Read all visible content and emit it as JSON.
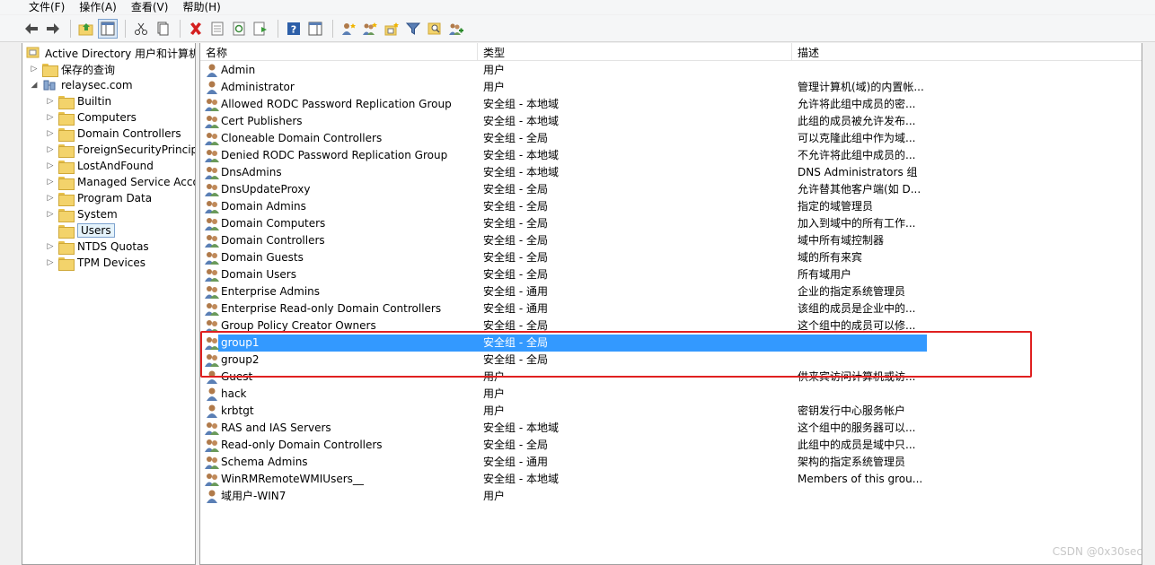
{
  "menubar": {
    "items": [
      "文件(F)",
      "操作(A)",
      "查看(V)",
      "帮助(H)"
    ]
  },
  "toolbar": {
    "buttons": [
      "back-icon",
      "forward-icon",
      "up-folder-icon",
      "show-console-tree-icon",
      "cut-icon",
      "copy-icon",
      "delete-icon",
      "properties-icon",
      "refresh-icon",
      "export-list-icon",
      "help-icon",
      "action-pane-icon",
      "new-user-icon",
      "new-group-icon",
      "new-ou-icon",
      "filter-icon",
      "find-icon",
      "add-to-group-icon"
    ]
  },
  "tree": {
    "root": "Active Directory 用户和计算机",
    "saved_queries": "保存的查询",
    "domain": "relaysec.com",
    "containers": [
      "Builtin",
      "Computers",
      "Domain Controllers",
      "ForeignSecurityPrincipals",
      "LostAndFound",
      "Managed Service Accounts",
      "Program Data",
      "System",
      "Users",
      "NTDS Quotas",
      "TPM Devices"
    ],
    "selected": "Users"
  },
  "list": {
    "columns": [
      "名称",
      "类型",
      "描述"
    ],
    "rows": [
      {
        "name": "Admin",
        "type": "用户",
        "desc": "",
        "icon": "user-icon"
      },
      {
        "name": "Administrator",
        "type": "用户",
        "desc": "管理计算机(域)的内置帐...",
        "icon": "user-icon"
      },
      {
        "name": "Allowed RODC Password Replication Group",
        "type": "安全组 - 本地域",
        "desc": "允许将此组中成员的密...",
        "icon": "group-icon"
      },
      {
        "name": "Cert Publishers",
        "type": "安全组 - 本地域",
        "desc": "此组的成员被允许发布...",
        "icon": "group-icon"
      },
      {
        "name": "Cloneable Domain Controllers",
        "type": "安全组 - 全局",
        "desc": "可以克隆此组中作为域...",
        "icon": "group-icon"
      },
      {
        "name": "Denied RODC Password Replication Group",
        "type": "安全组 - 本地域",
        "desc": "不允许将此组中成员的...",
        "icon": "group-icon"
      },
      {
        "name": "DnsAdmins",
        "type": "安全组 - 本地域",
        "desc": "DNS Administrators 组",
        "icon": "group-icon"
      },
      {
        "name": "DnsUpdateProxy",
        "type": "安全组 - 全局",
        "desc": "允许替其他客户端(如 D...",
        "icon": "group-icon"
      },
      {
        "name": "Domain Admins",
        "type": "安全组 - 全局",
        "desc": "指定的域管理员",
        "icon": "group-icon"
      },
      {
        "name": "Domain Computers",
        "type": "安全组 - 全局",
        "desc": "加入到域中的所有工作...",
        "icon": "group-icon"
      },
      {
        "name": "Domain Controllers",
        "type": "安全组 - 全局",
        "desc": "域中所有域控制器",
        "icon": "group-icon"
      },
      {
        "name": "Domain Guests",
        "type": "安全组 - 全局",
        "desc": "域的所有来宾",
        "icon": "group-icon"
      },
      {
        "name": "Domain Users",
        "type": "安全组 - 全局",
        "desc": "所有域用户",
        "icon": "group-icon"
      },
      {
        "name": "Enterprise Admins",
        "type": "安全组 - 通用",
        "desc": "企业的指定系统管理员",
        "icon": "group-icon"
      },
      {
        "name": "Enterprise Read-only Domain Controllers",
        "type": "安全组 - 通用",
        "desc": "该组的成员是企业中的...",
        "icon": "group-icon"
      },
      {
        "name": "Group Policy Creator Owners",
        "type": "安全组 - 全局",
        "desc": "这个组中的成员可以修...",
        "icon": "group-icon"
      },
      {
        "name": "group1",
        "type": "安全组 - 全局",
        "desc": "",
        "icon": "group-icon",
        "selected": true
      },
      {
        "name": "group2",
        "type": "安全组 - 全局",
        "desc": "",
        "icon": "group-icon"
      },
      {
        "name": "Guest",
        "type": "用户",
        "desc": "供来宾访问计算机或访...",
        "icon": "user-icon"
      },
      {
        "name": "hack",
        "type": "用户",
        "desc": "",
        "icon": "user-icon"
      },
      {
        "name": "krbtgt",
        "type": "用户",
        "desc": "密钥发行中心服务帐户",
        "icon": "user-icon"
      },
      {
        "name": "RAS and IAS Servers",
        "type": "安全组 - 本地域",
        "desc": "这个组中的服务器可以...",
        "icon": "group-icon"
      },
      {
        "name": "Read-only Domain Controllers",
        "type": "安全组 - 全局",
        "desc": "此组中的成员是域中只...",
        "icon": "group-icon"
      },
      {
        "name": "Schema Admins",
        "type": "安全组 - 通用",
        "desc": "架构的指定系统管理员",
        "icon": "group-icon"
      },
      {
        "name": "WinRMRemoteWMIUsers__",
        "type": "安全组 - 本地域",
        "desc": "Members of this grou...",
        "icon": "group-icon"
      },
      {
        "name": "域用户-WIN7",
        "type": "用户",
        "desc": "",
        "icon": "user-icon"
      }
    ]
  },
  "watermark": "CSDN @0x30sec",
  "colors": {
    "selection": "#3399ff",
    "highlight_box": "#e02020"
  }
}
